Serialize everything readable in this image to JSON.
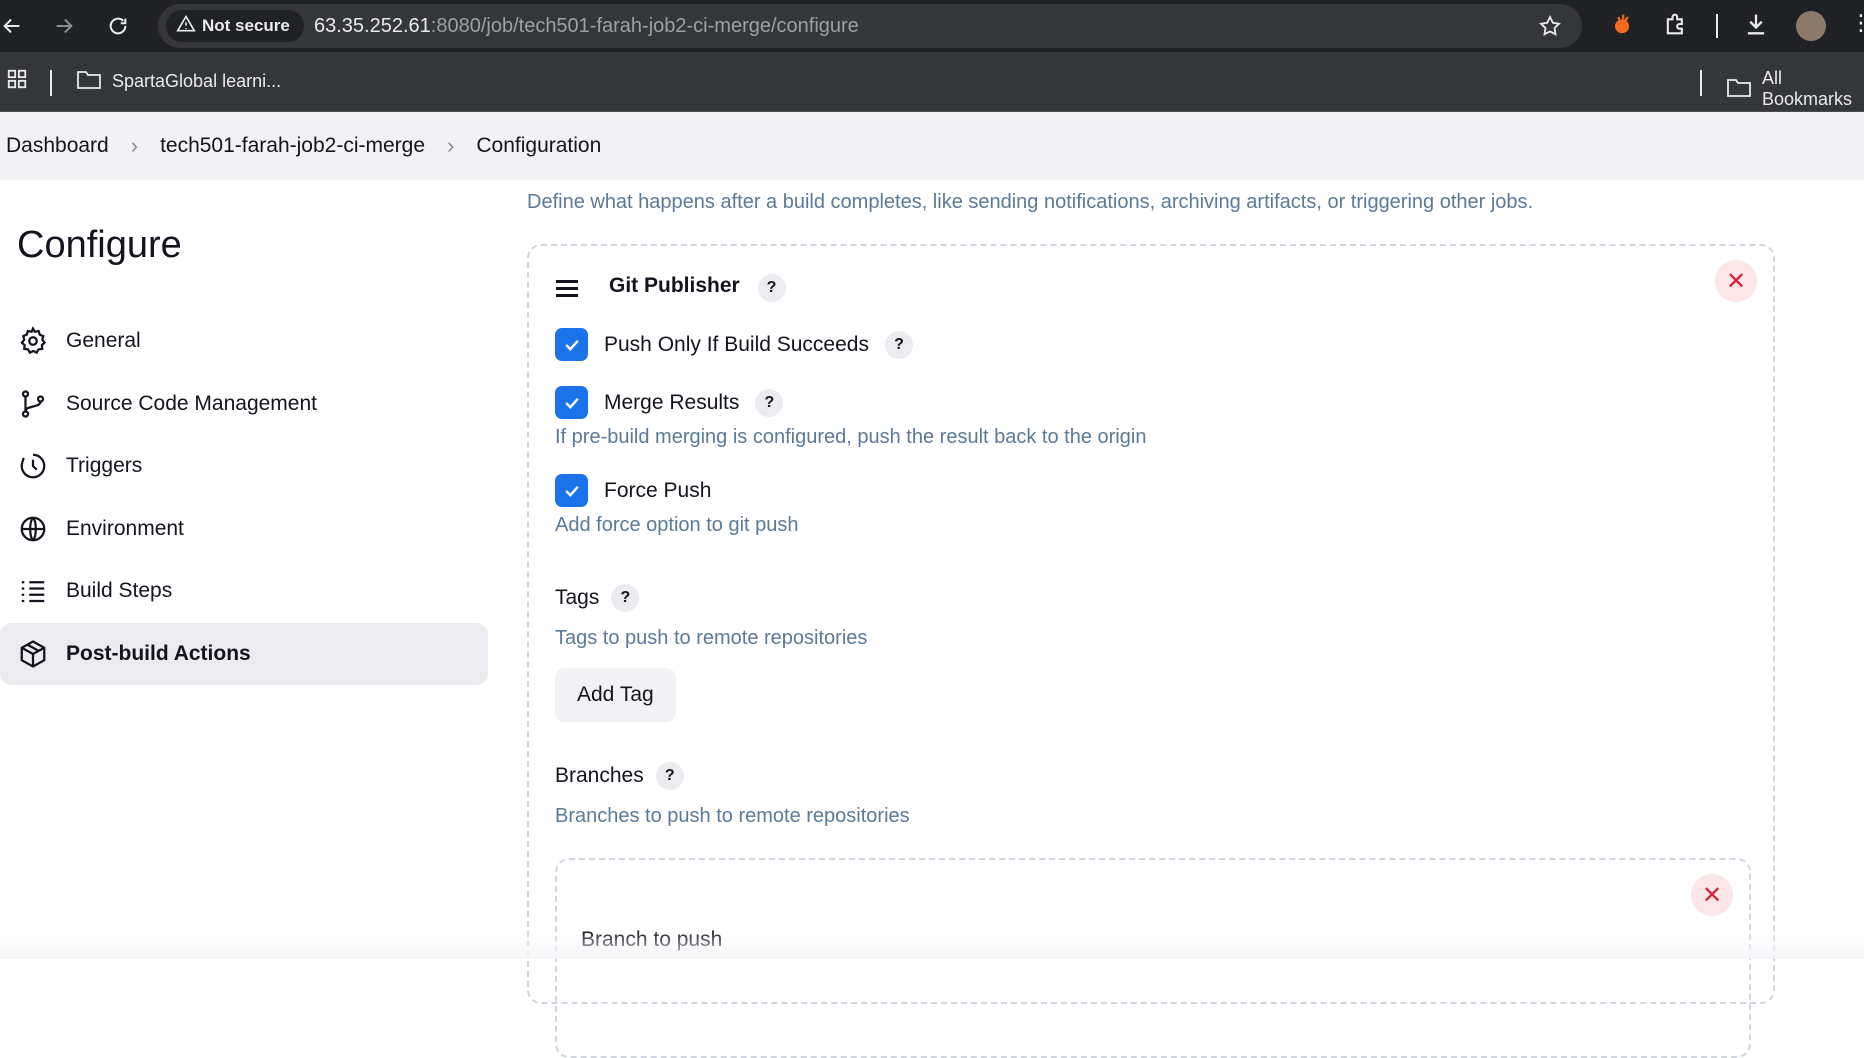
{
  "browser": {
    "security_label": "Not secure",
    "url_host": "63.35.252.61",
    "url_rest": ":8080/job/tech501-farah-job2-ci-merge/configure",
    "bookmarks": [
      {
        "label": "SpartaGlobal learni..."
      },
      {
        "label": "All Bookmarks"
      }
    ]
  },
  "breadcrumb": {
    "items": [
      "Dashboard",
      "tech501-farah-job2-ci-merge",
      "Configuration"
    ]
  },
  "sidebar": {
    "title": "Configure",
    "items": [
      {
        "label": "General",
        "icon": "gear-icon"
      },
      {
        "label": "Source Code Management",
        "icon": "git-branch-icon"
      },
      {
        "label": "Triggers",
        "icon": "clock-icon"
      },
      {
        "label": "Environment",
        "icon": "globe-icon"
      },
      {
        "label": "Build Steps",
        "icon": "list-icon"
      },
      {
        "label": "Post-build Actions",
        "icon": "package-icon",
        "active": true
      }
    ]
  },
  "main": {
    "section_description": "Define what happens after a build completes, like sending notifications, archiving artifacts, or triggering other jobs.",
    "git_publisher": {
      "title": "Git Publisher",
      "push_only_if_success": {
        "label": "Push Only If Build Succeeds",
        "checked": true
      },
      "merge_results": {
        "label": "Merge Results",
        "checked": true,
        "description": "If pre-build merging is configured, push the result back to the origin"
      },
      "force_push": {
        "label": "Force Push",
        "checked": true,
        "description": "Add force option to git push"
      },
      "tags": {
        "label": "Tags",
        "description": "Tags to push to remote repositories",
        "add_button": "Add Tag"
      },
      "branches": {
        "label": "Branches",
        "description": "Branches to push to remote repositories",
        "branch_to_push_label": "Branch to push"
      }
    }
  },
  "colors": {
    "accent": "#1a73e8",
    "description_text": "#5b7a99",
    "danger": "#d3243a"
  }
}
